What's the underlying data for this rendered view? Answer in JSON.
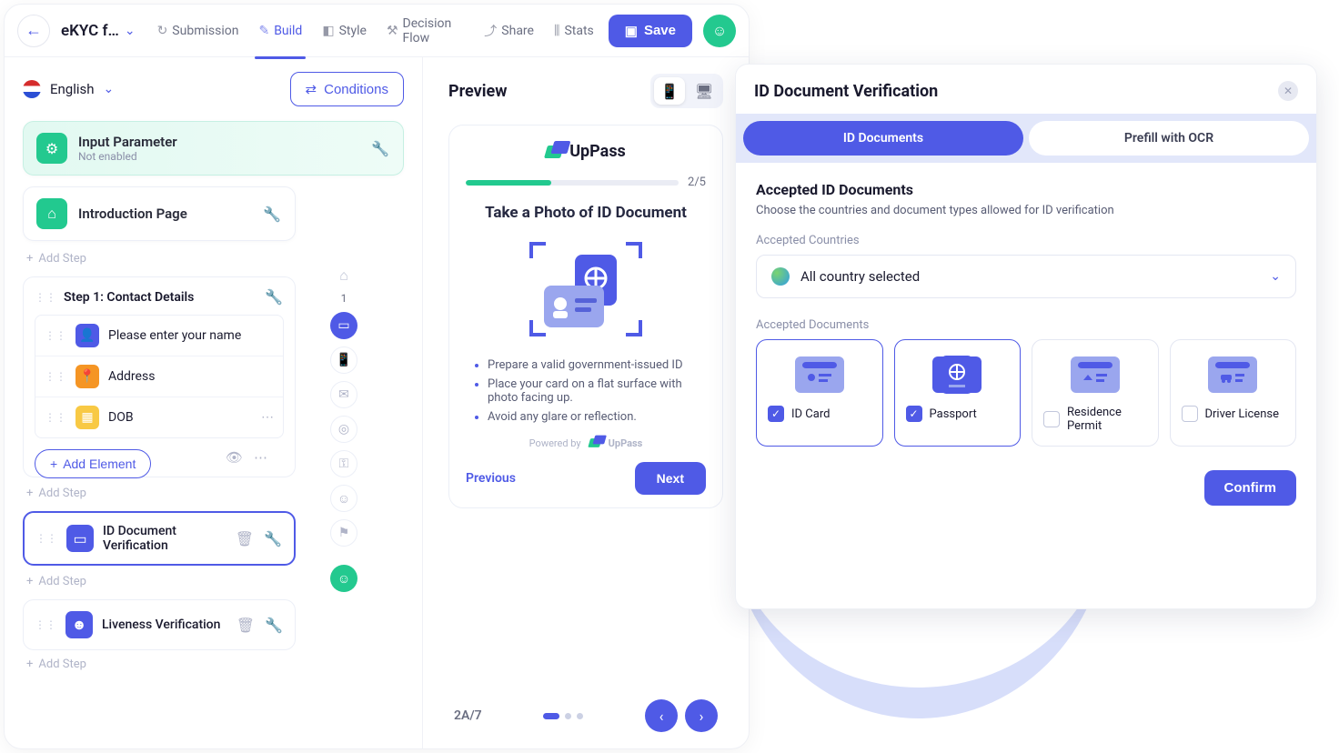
{
  "header": {
    "title": "eKYC f…",
    "tabs": {
      "submission": "Submission",
      "build": "Build",
      "style": "Style",
      "decision_flow": "Decision Flow",
      "share": "Share",
      "stats": "Stats"
    },
    "save_label": "Save"
  },
  "left": {
    "language": "English",
    "conditions_label": "Conditions",
    "input_parameter": {
      "title": "Input Parameter",
      "sub": "Not enabled"
    },
    "intro_page": "Introduction Page",
    "add_step": "Add Step",
    "step1_title": "Step 1: Contact Details",
    "fields": {
      "name": "Please enter your name",
      "address": "Address",
      "dob": "DOB"
    },
    "add_element": "Add Element",
    "id_doc_step": "ID Document Verification",
    "liveness_step": "Liveness Verification",
    "rail_num": "1"
  },
  "preview": {
    "title": "Preview",
    "brand": "UpPass",
    "progress_total": "2/5",
    "progress_pct": 40,
    "phone_title": "Take a Photo of ID Document",
    "bullets": {
      "b1": "Prepare a valid government-issued ID",
      "b2": "Place your card on a flat surface with photo facing up.",
      "b3": "Avoid any glare or reflection."
    },
    "powered_by": "Powered by",
    "previous": "Previous",
    "next": "Next",
    "pager": "2A/7"
  },
  "panel": {
    "title": "ID Document Verification",
    "seg_docs": "ID Documents",
    "seg_ocr": "Prefill with OCR",
    "section_title": "Accepted ID Documents",
    "section_sub": "Choose the countries and document types allowed for ID verification",
    "countries_label": "Accepted Countries",
    "countries_value": "All country selected",
    "docs_label": "Accepted Documents",
    "doc_idcard": "ID Card",
    "doc_passport": "Passport",
    "doc_residence": "Residence Permit",
    "doc_driver": "Driver License",
    "confirm": "Confirm"
  }
}
